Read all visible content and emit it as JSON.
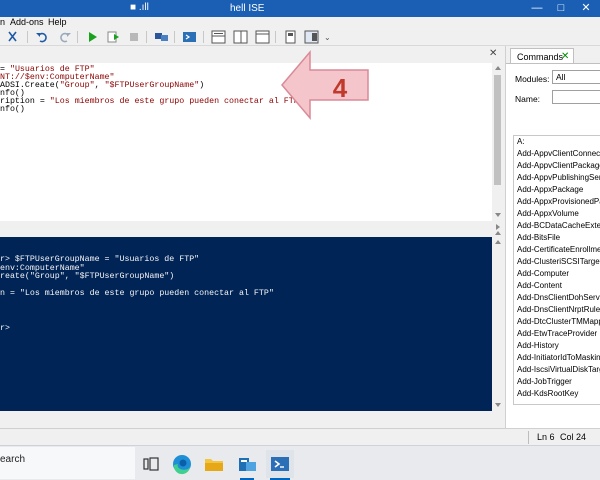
{
  "window": {
    "title": "hell ISE",
    "quick_access": "■ .ıll",
    "min_glyph": "—",
    "max_glyph": "□",
    "close_glyph": "✕"
  },
  "menu": {
    "items": [
      "n",
      "Add-ons",
      "Help"
    ]
  },
  "tab_strip": {
    "close_glyph": "✕"
  },
  "editor": {
    "lines": [
      {
        "parts": [
          {
            "cls": "plain",
            "text": "= "
          },
          {
            "cls": "str",
            "text": "\"Usuarios de FTP\""
          }
        ]
      },
      {
        "parts": [
          {
            "cls": "str",
            "text": "NT://$env:ComputerName\""
          }
        ]
      },
      {
        "parts": [
          {
            "cls": "plain",
            "text": "ADSI.Create("
          },
          {
            "cls": "str",
            "text": "\"Group\""
          },
          {
            "cls": "plain",
            "text": ", "
          },
          {
            "cls": "str",
            "text": "\"$FTPUserGroupName\""
          },
          {
            "cls": "plain",
            "text": ")"
          }
        ]
      },
      {
        "parts": [
          {
            "cls": "plain",
            "text": "nfo()"
          }
        ]
      },
      {
        "parts": [
          {
            "cls": "plain",
            "text": "ription = "
          },
          {
            "cls": "str",
            "text": "\"Los miembros de este grupo pueden conectar al FTP\""
          }
        ]
      },
      {
        "parts": [
          {
            "cls": "plain",
            "text": "nfo()"
          }
        ]
      }
    ]
  },
  "callout": {
    "label": "4",
    "fill": "#f4c6cc",
    "stroke": "#d98a96",
    "text_color": "#c0392b"
  },
  "console": {
    "lines": [
      "r> $FTPUserGroupName = \"Usuarios de FTP\"",
      "env:ComputerName\"",
      "reate(\"Group\", \"$FTPUserGroupName\")",
      "",
      "n = \"Los miembros de este grupo pueden conectar al FTP\"",
      "",
      "",
      "",
      "r>"
    ]
  },
  "commands": {
    "tab_label": "Commands",
    "tab_close": "✕",
    "modules_label": "Modules:",
    "modules_value": "All",
    "name_label": "Name:",
    "name_value": "",
    "items": [
      "A:",
      "Add-AppvClientConnectionGroup",
      "Add-AppvClientPackage",
      "Add-AppvPublishingServer",
      "Add-AppxPackage",
      "Add-AppxProvisionedPackage",
      "Add-AppxVolume",
      "Add-BCDataCacheExtension",
      "Add-BitsFile",
      "Add-CertificateEnrollmentPolicyServer",
      "Add-ClusteriSCSITargetServerRole",
      "Add-Computer",
      "Add-Content",
      "Add-DnsClientDohServerAddress",
      "Add-DnsClientNrptRule",
      "Add-DtcClusterTMMapping",
      "Add-EtwTraceProvider",
      "Add-History",
      "Add-InitiatorIdToMaskingSet",
      "Add-IscsiVirtualDiskTargetMapping",
      "Add-JobTrigger",
      "Add-KdsRootKey"
    ]
  },
  "status": {
    "line": "Ln 6",
    "col": "Col 24"
  },
  "taskbar": {
    "search_text": "earch",
    "apps": [
      "task-view",
      "edge",
      "file-explorer",
      "server-manager",
      "powershell"
    ],
    "active_app": "powershell"
  },
  "colors": {
    "title_bar": "#1a5fb4",
    "console_bg": "#012456",
    "string": "#8b0000",
    "accent": "#0067c0"
  }
}
